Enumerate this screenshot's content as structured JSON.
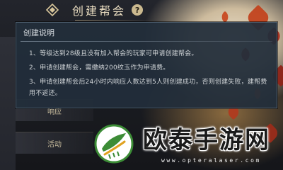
{
  "header": {
    "title": "创建帮会",
    "help_symbol": "?"
  },
  "left_menu": {
    "items": [
      {
        "label": "响应"
      },
      {
        "label": "活动"
      }
    ]
  },
  "dialog": {
    "title": "创建说明",
    "rules": [
      "1、等级达到28级且没有加入帮会的玩家可申请创建帮会。",
      "2、申请创建帮会，需缴纳200纹玉作为申请费。",
      "3、申请创建帮会后24小时内响应人数达到5人则创建成功，否则创建失败，建帮费用不返还。"
    ]
  },
  "watermark": {
    "brand": "欧泰手游网",
    "url": "www.opteralaser.com"
  },
  "colors": {
    "dialog_bg": "#222e3a",
    "dialog_border": "#4d5f70",
    "title_gold": "#e9dcc0",
    "leaf_red": "#b13521",
    "logo_green": "#3c8c36"
  },
  "icons": [
    "back-arrow-icon",
    "help-icon",
    "brand-logo-icon"
  ]
}
